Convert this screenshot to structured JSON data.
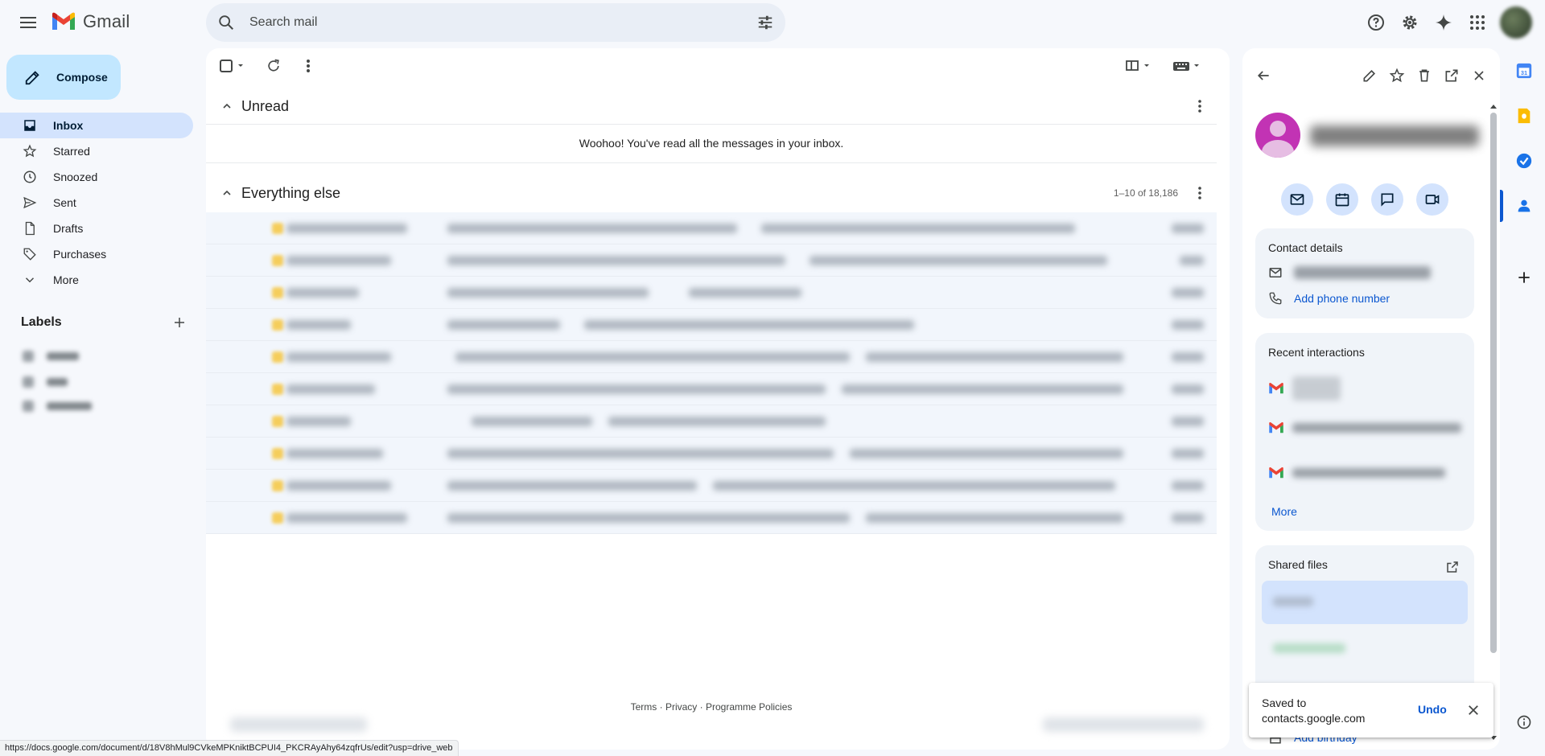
{
  "app": {
    "name": "Gmail"
  },
  "search": {
    "placeholder": "Search mail"
  },
  "compose": {
    "label": "Compose"
  },
  "nav": [
    {
      "label": "Inbox",
      "icon": "inbox-icon",
      "active": true
    },
    {
      "label": "Starred",
      "icon": "star-icon"
    },
    {
      "label": "Snoozed",
      "icon": "clock-icon"
    },
    {
      "label": "Sent",
      "icon": "send-icon"
    },
    {
      "label": "Drafts",
      "icon": "draft-icon"
    },
    {
      "label": "Purchases",
      "icon": "tag-icon"
    },
    {
      "label": "More",
      "icon": "chevron-down-icon"
    }
  ],
  "labels": {
    "title": "Labels"
  },
  "sections": {
    "unread": {
      "title": "Unread",
      "empty_message": "Woohoo! You've read all the messages in your inbox."
    },
    "everything_else": {
      "title": "Everything else",
      "range": "1–10 of 18,186"
    }
  },
  "footer": {
    "terms": "Terms",
    "privacy": "Privacy",
    "policies": "Programme Policies",
    "sep": "·"
  },
  "contact_panel": {
    "details": {
      "title": "Contact details",
      "add_phone": "Add phone number"
    },
    "recent": {
      "title": "Recent interactions",
      "more": "More"
    },
    "files": {
      "title": "Shared files"
    },
    "add_birthday": "Add birthday"
  },
  "toast": {
    "message": "Saved to contacts.google.com",
    "undo": "Undo"
  },
  "status_url": "https://docs.google.com/document/d/18V8hMul9CVkeMPKniktBCPUI4_PKCRAyAhy64zqfrUs/edit?usp=drive_web",
  "colors": {
    "accent": "#0b57d0",
    "compose_bg": "#c2e7ff",
    "active_nav": "#d3e3fd",
    "avatar": "#c233b4"
  }
}
